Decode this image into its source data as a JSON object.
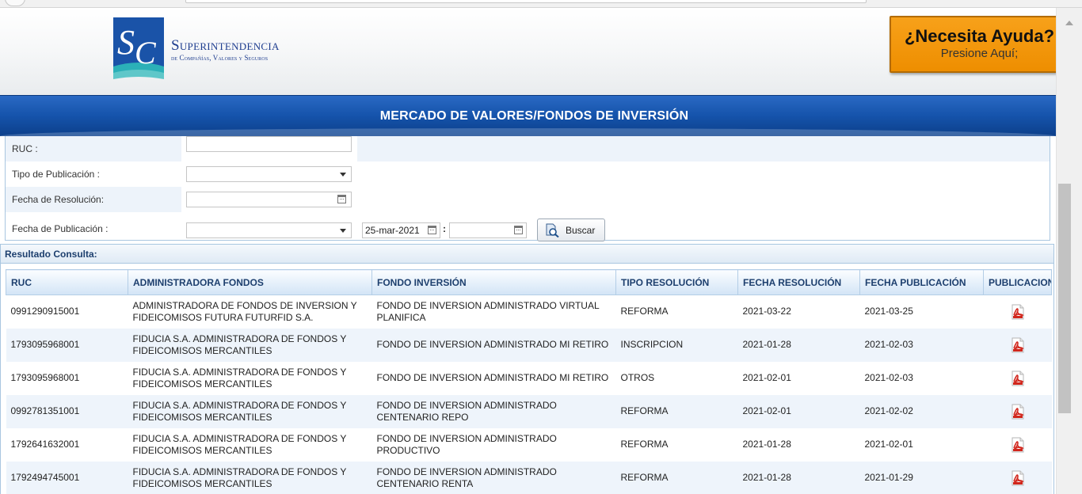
{
  "header": {
    "brand_name": "Superintendencia",
    "brand_sub": "de Compañías, Valores y Seguros",
    "help_title": "¿Necesita Ayuda?",
    "help_sub": "Presione Aquí;"
  },
  "banner": {
    "title": "MERCADO DE VALORES/FONDOS DE INVERSIÓN"
  },
  "form": {
    "ruc_label": "RUC :",
    "ruc_value": "",
    "tipo_label": "Tipo de Publicación :",
    "tipo_value": "",
    "fecha_res_label": "Fecha de Resolución:",
    "fecha_res_value": "",
    "fecha_pub_label": "Fecha de Publicación :",
    "fecha_pub_select": "",
    "fecha_pub_from": "25-mar-2021",
    "range_sep": ":",
    "fecha_pub_to": "",
    "buscar_label": "Buscar"
  },
  "results": {
    "title": "Resultado Consulta:",
    "columns": [
      "RUC",
      "ADMINISTRADORA FONDOS",
      "FONDO INVERSIÓN",
      "TIPO RESOLUCIÓN",
      "FECHA RESOLUCIÓN",
      "FECHA PUBLICACIÓN",
      "PUBLICACION"
    ],
    "rows": [
      [
        "0991290915001",
        "ADMINISTRADORA DE FONDOS DE INVERSION Y FIDEICOMISOS FUTURA FUTURFID S.A.",
        "FONDO DE INVERSION ADMINISTRADO VIRTUAL PLANIFICA",
        "REFORMA",
        "2021-03-22",
        "2021-03-25"
      ],
      [
        "1793095968001",
        "FIDUCIA S.A. ADMINISTRADORA DE FONDOS Y FIDEICOMISOS MERCANTILES",
        "FONDO DE INVERSION ADMINISTRADO MI RETIRO",
        "INSCRIPCION",
        "2021-01-28",
        "2021-02-03"
      ],
      [
        "1793095968001",
        "FIDUCIA S.A. ADMINISTRADORA DE FONDOS Y FIDEICOMISOS MERCANTILES",
        "FONDO DE INVERSION ADMINISTRADO MI RETIRO",
        "OTROS",
        "2021-02-01",
        "2021-02-03"
      ],
      [
        "0992781351001",
        "FIDUCIA S.A. ADMINISTRADORA DE FONDOS Y FIDEICOMISOS MERCANTILES",
        "FONDO DE INVERSION ADMINISTRADO CENTENARIO REPO",
        "REFORMA",
        "2021-02-01",
        "2021-02-02"
      ],
      [
        "1792641632001",
        "FIDUCIA S.A. ADMINISTRADORA DE FONDOS Y FIDEICOMISOS MERCANTILES",
        "FONDO DE INVERSION ADMINISTRADO PRODUCTIVO",
        "REFORMA",
        "2021-01-28",
        "2021-02-01"
      ],
      [
        "1792494745001",
        "FIDUCIA S.A. ADMINISTRADORA DE FONDOS Y FIDEICOMISOS MERCANTILES",
        "FONDO DE INVERSION ADMINISTRADO CENTENARIO RENTA",
        "REFORMA",
        "2021-01-28",
        "2021-01-29"
      ]
    ]
  },
  "colors": {
    "banner_blue": "#1553ab",
    "help_orange": "#f39a10",
    "header_text": "#1d3f6e",
    "pdf_red": "#d1261c"
  },
  "icons": {
    "logo": "sc-logo-icon",
    "buscar": "search-document-icon",
    "publicacion": "pdf-icon",
    "calendar": "calendar-icon",
    "select": "chevron-down-icon"
  }
}
